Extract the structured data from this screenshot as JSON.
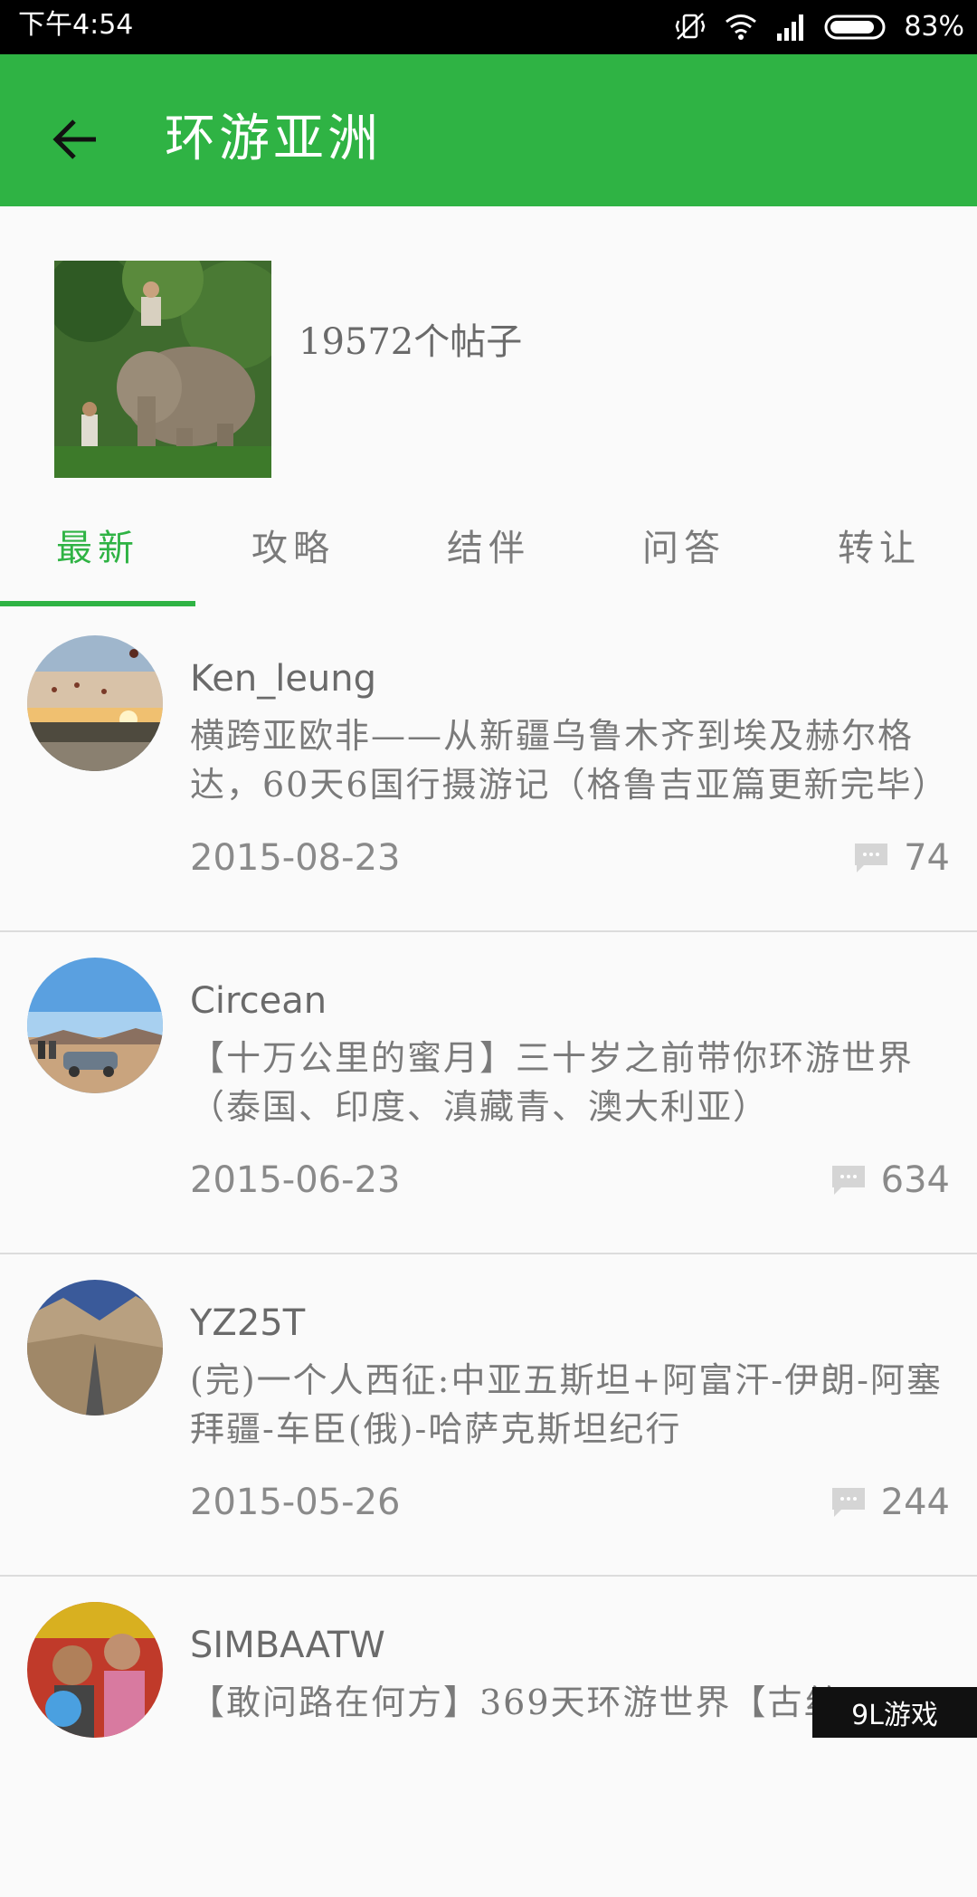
{
  "status_bar": {
    "time": "下午4:54",
    "battery": "83%"
  },
  "app_bar": {
    "title": "环游亚洲"
  },
  "forum": {
    "post_count": "19572个帖子"
  },
  "tabs": [
    {
      "label": "最新"
    },
    {
      "label": "攻略"
    },
    {
      "label": "结伴"
    },
    {
      "label": "问答"
    },
    {
      "label": "转让"
    }
  ],
  "posts": [
    {
      "author": "Ken_leung",
      "title": "横跨亚欧非——从新疆乌鲁木齐到埃及赫尔格达，60天6国行摄游记（格鲁吉亚篇更新完毕）",
      "date": "2015-08-23",
      "comments": "74"
    },
    {
      "author": "Circean",
      "title": "【十万公里的蜜月】三十岁之前带你环游世界（泰国、印度、滇藏青、澳大利亚）",
      "date": "2015-06-23",
      "comments": "634"
    },
    {
      "author": "YZ25T",
      "title": "(完)一个人西征:中亚五斯坦+阿富汗-伊朗-阿塞拜疆-车臣(俄)-哈萨克斯坦纪行",
      "date": "2015-05-26",
      "comments": "244"
    },
    {
      "author": "SIMBAATW",
      "title": "【敢问路在何方】369天环游世界【古丝",
      "date": "",
      "comments": ""
    }
  ],
  "watermark": "9L游戏"
}
